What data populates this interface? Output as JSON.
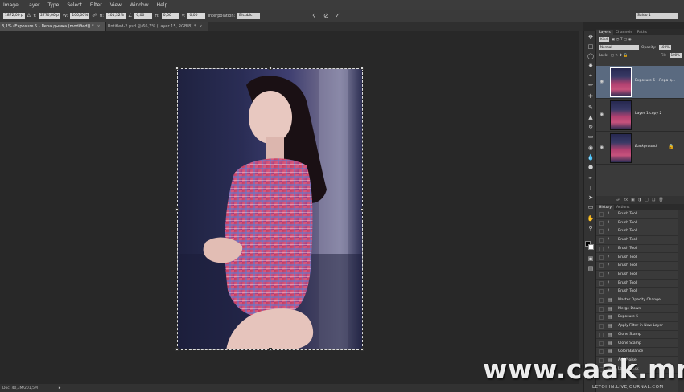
{
  "menu": [
    "Image",
    "Layer",
    "Type",
    "Select",
    "Filter",
    "View",
    "Window",
    "Help"
  ],
  "options": {
    "x_value": "1872,00 p",
    "y_label": "Y:",
    "y_value": "2770,00 p",
    "w_label": "W:",
    "w_value": "100,00%",
    "h_label": "H:",
    "h_value": "101,32%",
    "angle_value": "0,00",
    "hskew_label": "H:",
    "hskew_value": "0,00",
    "vskew_label": "V:",
    "vskew_value": "0,00",
    "interp_label": "Interpolation:",
    "interp_value": "Bicubic",
    "workspace_value": "Saldo 1"
  },
  "tabs": [
    {
      "label": "3,1% (Exposure 5 - Лера дымка (modified)) *",
      "active": true
    },
    {
      "label": "Untitled-2.psd @ 66,7% (Layer 15, RGB/8) *",
      "active": false
    }
  ],
  "status": {
    "doc": "Doc: 40,3M/201,5M"
  },
  "layers_panel": {
    "tabs": [
      "Layers",
      "Channels",
      "Paths"
    ],
    "kind_label": "Kind",
    "blend_mode": "Normal",
    "opacity_label": "Opacity:",
    "opacity_value": "100%",
    "lock_label": "Lock:",
    "fill_label": "Fill:",
    "fill_value": "100%",
    "layers": [
      {
        "name": "Exposure 5 - Лера д...",
        "selected": true
      },
      {
        "name": "Layer 1 copy 2",
        "selected": false
      },
      {
        "name": "Background",
        "selected": false
      }
    ]
  },
  "history_panel": {
    "tabs": [
      "History",
      "Actions"
    ],
    "items": [
      "Brush Tool",
      "Brush Tool",
      "Brush Tool",
      "Brush Tool",
      "Brush Tool",
      "Brush Tool",
      "Brush Tool",
      "Brush Tool",
      "Brush Tool",
      "Brush Tool",
      "Master Opacity Change",
      "Merge Down",
      "Exposure 5",
      "Apply Filter in New Layer",
      "Clone Stamp",
      "Clone Stamp",
      "Color Balance",
      "Add Noise",
      "Layer Mask"
    ]
  },
  "watermark": {
    "main": "www.caak.mn",
    "sub": "LETOHIN.LIVEJOURNAL.COM"
  },
  "colors": {
    "selected_layer": "#5a6a80",
    "menu_bg": "#3c3c3c",
    "canvas_bg": "#282828"
  }
}
